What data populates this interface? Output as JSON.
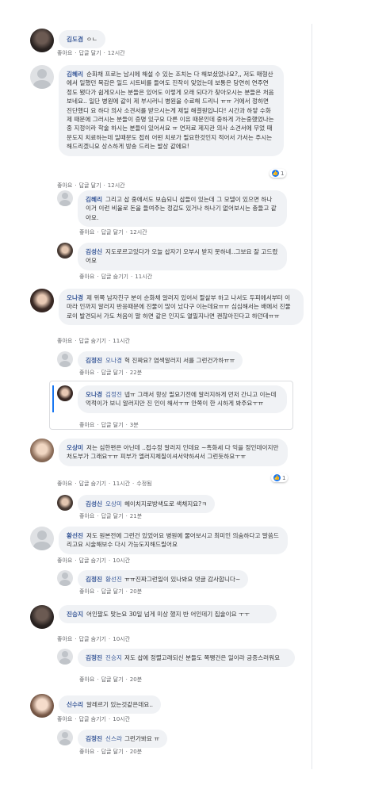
{
  "actions": {
    "like": "좋아요",
    "reply": "답글 달기",
    "hide": "답글 숨기기",
    "edited": "수정됨"
  },
  "c1": {
    "name": "김도겸",
    "text": "ㅇㄴ",
    "time": "12시간"
  },
  "c2": {
    "name": "김혜리",
    "text": "순화채 프로는 남시에 해설 수 있는 조치는 다 해보셨었나요?,, 저도 매형산에서 일했던 목감은 일드 시트비를 들여도 진작이 잊었는데 보통은 당연히 연주연 정도 됐다가 쉽게오시는 분들은 있어도 이렇게 오래 되다가 찾아오시는 분들은 처음보네요.. 일단 병원에 같이 제 부시러니 병원을 수료해 드리니 ㅠㅠ 거에서 정하면 진단했디 요 하다 의사 소견서를 받으시는게 제일 해결원입니다! 시간과 하얗 수화제 때문에 그러시는 분들이 증명 있구요 다른 이유 때문인데 중하게 가는중했었나는중 지정이라 학술 하시는 분들이 있어서요 ㅠ 면저료 제지관 의사 소견서에 무었 때문도지 치료하는데 일때문도 접히 어떤 치로가 필요한것인지 적어서 가서는 주시는 해드리겠니요 상스하게 방송 드리는 발상 같에요!",
    "time": "12시간",
    "reacts": "1"
  },
  "c3": {
    "name": "김혜리",
    "text": "그리고 삽 중에서도 보습되니 삽들이 있는데 그 모델이 있으면 하나 이거 이런 비율로 돈을 들여주는 정갑도 있거나 하나기 없어보시는 충들고 같아요.",
    "time": "12시간"
  },
  "c4": {
    "name": "김성신",
    "text": "지도로르고있다가 오늘 삽자기 오부시 받지 못하네..그보요 잘 고드렸어요",
    "time": "11시간"
  },
  "c5": {
    "name": "오나경",
    "text": "제 위쪽 남자친구 분이 순화채 알러지 있어서 팔살부 하고 나서도 두피에서부터 이마라 인까지 알러지 반응때문에 진물이 많이 났다구 이는데요ㅠㅠ 심심해서는 배에서 진물로이 발견되서 가도 처음이 말 하면 같은 인지도 열밀지나면 괜찮아진다고 하던데ㅠㅠ",
    "time": "11시간"
  },
  "c6": {
    "name": "김정진",
    "mention": "오나경",
    "text": "헉 진짜요? 염색알러지 서를 그런건가하ㅠㅠ",
    "time": "22분"
  },
  "c7": {
    "name": "오나경",
    "mention": "김정진",
    "text": "넵ㅠ 그래서 항상 필요기전에 알러지하게 먼저 간니고 이는데 억적이가 보니 알러지만 진 인이 해서ㅜㅠ 안쪽이 한 시하게 봐주요ㅜㅠ",
    "time": "3분"
  },
  "c8": {
    "name": "오상미",
    "text": "저는 심한편은 아닌데 ..접수정 알러지 인데요 ~흑화세 다 익을 정인데이지만 처도부가 그래요ㅜㅠ 피부가 엘러지체질이셔서약하셔서 그런듯하요ㅜㅠ",
    "time": "11시간",
    "reacts": "1"
  },
  "c9": {
    "name": "김성신",
    "mention": "오상미",
    "text": "헤이치지로방색도로 색채지요?ㅋ",
    "time": "21분"
  },
  "c10": {
    "name": "황선진",
    "text": "저도 원본전에 그런건 있었어요 병원에 물어보시고 최미인 의숨하다고 말씀드리고요 시술해보수 다시 가능도지해드릴어요",
    "time": "10시간"
  },
  "c11": {
    "name": "김정진",
    "mention": "황선진",
    "text": "ㅠㅠ진짜그런일이 있나봐요 댓글 감사합니다~",
    "time": "20분"
  },
  "c12": {
    "name": "진승지",
    "text": "어인팔도 맞는요 30일 넘게 미상 했지 반 어인데기 집술이요 ㅜㅜ",
    "time": "10시간"
  },
  "c13": {
    "name": "김정진",
    "mention": "진승지",
    "text": "저도 삽에 정렬고래되신 분들도 쪽쨍건은 일이라 긍증스러워요",
    "time": "20분"
  },
  "c14": {
    "name": "신수리",
    "text": "알레르기 있는것같은데요..",
    "time": "10시간"
  },
  "c15": {
    "name": "김정진",
    "mention": "신스라",
    "text": "그런가봐요 ㅠ",
    "time": "20분"
  }
}
